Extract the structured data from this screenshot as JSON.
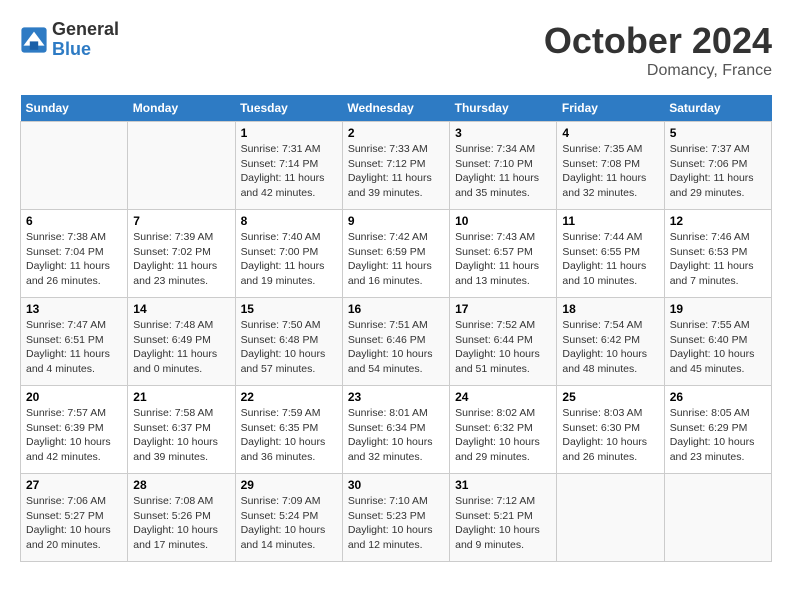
{
  "logo": {
    "line1": "General",
    "line2": "Blue"
  },
  "header": {
    "month": "October 2024",
    "location": "Domancy, France"
  },
  "weekdays": [
    "Sunday",
    "Monday",
    "Tuesday",
    "Wednesday",
    "Thursday",
    "Friday",
    "Saturday"
  ],
  "weeks": [
    [
      {
        "day": "",
        "sunrise": "",
        "sunset": "",
        "daylight": ""
      },
      {
        "day": "",
        "sunrise": "",
        "sunset": "",
        "daylight": ""
      },
      {
        "day": "1",
        "sunrise": "Sunrise: 7:31 AM",
        "sunset": "Sunset: 7:14 PM",
        "daylight": "Daylight: 11 hours and 42 minutes."
      },
      {
        "day": "2",
        "sunrise": "Sunrise: 7:33 AM",
        "sunset": "Sunset: 7:12 PM",
        "daylight": "Daylight: 11 hours and 39 minutes."
      },
      {
        "day": "3",
        "sunrise": "Sunrise: 7:34 AM",
        "sunset": "Sunset: 7:10 PM",
        "daylight": "Daylight: 11 hours and 35 minutes."
      },
      {
        "day": "4",
        "sunrise": "Sunrise: 7:35 AM",
        "sunset": "Sunset: 7:08 PM",
        "daylight": "Daylight: 11 hours and 32 minutes."
      },
      {
        "day": "5",
        "sunrise": "Sunrise: 7:37 AM",
        "sunset": "Sunset: 7:06 PM",
        "daylight": "Daylight: 11 hours and 29 minutes."
      }
    ],
    [
      {
        "day": "6",
        "sunrise": "Sunrise: 7:38 AM",
        "sunset": "Sunset: 7:04 PM",
        "daylight": "Daylight: 11 hours and 26 minutes."
      },
      {
        "day": "7",
        "sunrise": "Sunrise: 7:39 AM",
        "sunset": "Sunset: 7:02 PM",
        "daylight": "Daylight: 11 hours and 23 minutes."
      },
      {
        "day": "8",
        "sunrise": "Sunrise: 7:40 AM",
        "sunset": "Sunset: 7:00 PM",
        "daylight": "Daylight: 11 hours and 19 minutes."
      },
      {
        "day": "9",
        "sunrise": "Sunrise: 7:42 AM",
        "sunset": "Sunset: 6:59 PM",
        "daylight": "Daylight: 11 hours and 16 minutes."
      },
      {
        "day": "10",
        "sunrise": "Sunrise: 7:43 AM",
        "sunset": "Sunset: 6:57 PM",
        "daylight": "Daylight: 11 hours and 13 minutes."
      },
      {
        "day": "11",
        "sunrise": "Sunrise: 7:44 AM",
        "sunset": "Sunset: 6:55 PM",
        "daylight": "Daylight: 11 hours and 10 minutes."
      },
      {
        "day": "12",
        "sunrise": "Sunrise: 7:46 AM",
        "sunset": "Sunset: 6:53 PM",
        "daylight": "Daylight: 11 hours and 7 minutes."
      }
    ],
    [
      {
        "day": "13",
        "sunrise": "Sunrise: 7:47 AM",
        "sunset": "Sunset: 6:51 PM",
        "daylight": "Daylight: 11 hours and 4 minutes."
      },
      {
        "day": "14",
        "sunrise": "Sunrise: 7:48 AM",
        "sunset": "Sunset: 6:49 PM",
        "daylight": "Daylight: 11 hours and 0 minutes."
      },
      {
        "day": "15",
        "sunrise": "Sunrise: 7:50 AM",
        "sunset": "Sunset: 6:48 PM",
        "daylight": "Daylight: 10 hours and 57 minutes."
      },
      {
        "day": "16",
        "sunrise": "Sunrise: 7:51 AM",
        "sunset": "Sunset: 6:46 PM",
        "daylight": "Daylight: 10 hours and 54 minutes."
      },
      {
        "day": "17",
        "sunrise": "Sunrise: 7:52 AM",
        "sunset": "Sunset: 6:44 PM",
        "daylight": "Daylight: 10 hours and 51 minutes."
      },
      {
        "day": "18",
        "sunrise": "Sunrise: 7:54 AM",
        "sunset": "Sunset: 6:42 PM",
        "daylight": "Daylight: 10 hours and 48 minutes."
      },
      {
        "day": "19",
        "sunrise": "Sunrise: 7:55 AM",
        "sunset": "Sunset: 6:40 PM",
        "daylight": "Daylight: 10 hours and 45 minutes."
      }
    ],
    [
      {
        "day": "20",
        "sunrise": "Sunrise: 7:57 AM",
        "sunset": "Sunset: 6:39 PM",
        "daylight": "Daylight: 10 hours and 42 minutes."
      },
      {
        "day": "21",
        "sunrise": "Sunrise: 7:58 AM",
        "sunset": "Sunset: 6:37 PM",
        "daylight": "Daylight: 10 hours and 39 minutes."
      },
      {
        "day": "22",
        "sunrise": "Sunrise: 7:59 AM",
        "sunset": "Sunset: 6:35 PM",
        "daylight": "Daylight: 10 hours and 36 minutes."
      },
      {
        "day": "23",
        "sunrise": "Sunrise: 8:01 AM",
        "sunset": "Sunset: 6:34 PM",
        "daylight": "Daylight: 10 hours and 32 minutes."
      },
      {
        "day": "24",
        "sunrise": "Sunrise: 8:02 AM",
        "sunset": "Sunset: 6:32 PM",
        "daylight": "Daylight: 10 hours and 29 minutes."
      },
      {
        "day": "25",
        "sunrise": "Sunrise: 8:03 AM",
        "sunset": "Sunset: 6:30 PM",
        "daylight": "Daylight: 10 hours and 26 minutes."
      },
      {
        "day": "26",
        "sunrise": "Sunrise: 8:05 AM",
        "sunset": "Sunset: 6:29 PM",
        "daylight": "Daylight: 10 hours and 23 minutes."
      }
    ],
    [
      {
        "day": "27",
        "sunrise": "Sunrise: 7:06 AM",
        "sunset": "Sunset: 5:27 PM",
        "daylight": "Daylight: 10 hours and 20 minutes."
      },
      {
        "day": "28",
        "sunrise": "Sunrise: 7:08 AM",
        "sunset": "Sunset: 5:26 PM",
        "daylight": "Daylight: 10 hours and 17 minutes."
      },
      {
        "day": "29",
        "sunrise": "Sunrise: 7:09 AM",
        "sunset": "Sunset: 5:24 PM",
        "daylight": "Daylight: 10 hours and 14 minutes."
      },
      {
        "day": "30",
        "sunrise": "Sunrise: 7:10 AM",
        "sunset": "Sunset: 5:23 PM",
        "daylight": "Daylight: 10 hours and 12 minutes."
      },
      {
        "day": "31",
        "sunrise": "Sunrise: 7:12 AM",
        "sunset": "Sunset: 5:21 PM",
        "daylight": "Daylight: 10 hours and 9 minutes."
      },
      {
        "day": "",
        "sunrise": "",
        "sunset": "",
        "daylight": ""
      },
      {
        "day": "",
        "sunrise": "",
        "sunset": "",
        "daylight": ""
      }
    ]
  ]
}
